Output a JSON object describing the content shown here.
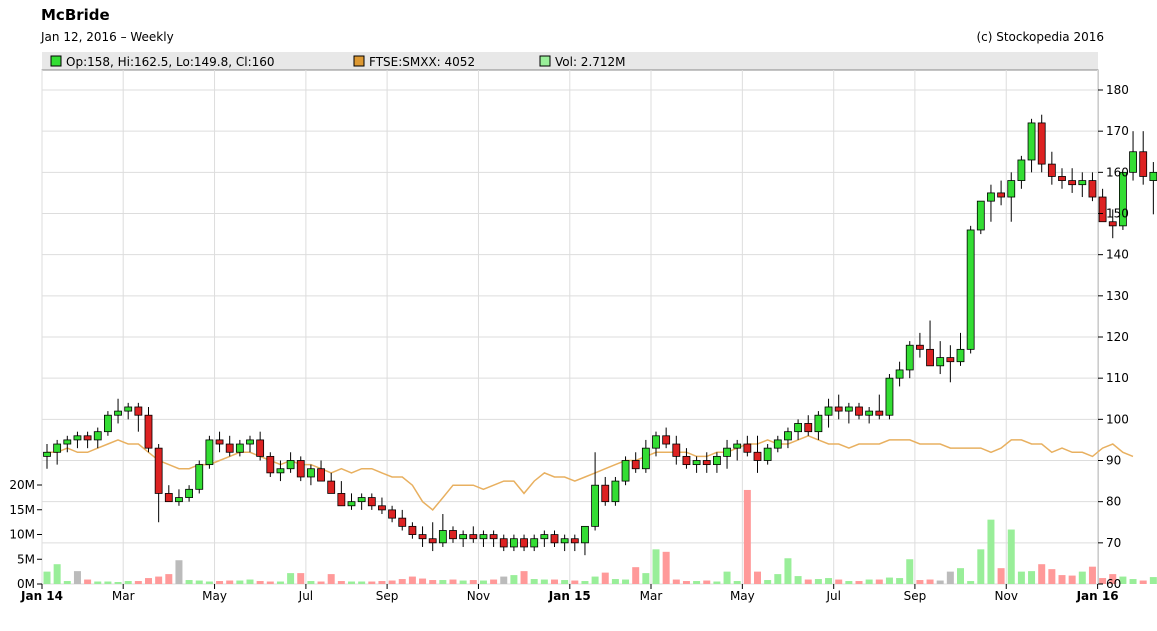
{
  "header": {
    "title": "McBride",
    "subtitle": "Jan 12, 2016 – Weekly",
    "credit": "(c) Stockopedia 2016"
  },
  "legend": [
    {
      "label": "Op:158, Hi:162.5, Lo:149.8, Cl:160",
      "color": "#33dd33"
    },
    {
      "label": "FTSE:SMXX: 4052",
      "color": "#dd9933"
    },
    {
      "label": "Vol: 2.712M",
      "color": "#99ee99"
    }
  ],
  "chart_data": {
    "type": "candlestick",
    "period": "Weekly",
    "x_range": [
      "2014-01-06",
      "2016-01-11"
    ],
    "y_right": {
      "min": 60,
      "max": 185,
      "ticks": [
        60,
        70,
        80,
        90,
        100,
        110,
        120,
        130,
        140,
        150,
        160,
        170,
        180
      ]
    },
    "volume_axis": {
      "unit": "M",
      "ticks": [
        "0M",
        "5M",
        "10M",
        "15M",
        "20M"
      ],
      "values": [
        0,
        5,
        10,
        15,
        20
      ]
    },
    "x_ticks": [
      {
        "label": "Jan 14",
        "bold": true,
        "week": 0
      },
      {
        "label": "Mar",
        "bold": false,
        "week": 8
      },
      {
        "label": "May",
        "bold": false,
        "week": 17
      },
      {
        "label": "Jul",
        "bold": false,
        "week": 26
      },
      {
        "label": "Sep",
        "bold": false,
        "week": 34
      },
      {
        "label": "Nov",
        "bold": false,
        "week": 43
      },
      {
        "label": "Jan 15",
        "bold": true,
        "week": 52
      },
      {
        "label": "Mar",
        "bold": false,
        "week": 60
      },
      {
        "label": "May",
        "bold": false,
        "week": 69
      },
      {
        "label": "Jul",
        "bold": false,
        "week": 78
      },
      {
        "label": "Sep",
        "bold": false,
        "week": 86
      },
      {
        "label": "Nov",
        "bold": false,
        "week": 95
      },
      {
        "label": "Jan 16",
        "bold": true,
        "week": 104
      }
    ],
    "colors": {
      "up": "#33dd33",
      "down": "#dd2222",
      "index": "#e8b060",
      "vol_up": "#99ee99",
      "vol_down": "#ff9999",
      "vol_flat": "#bbbbbb"
    },
    "candles": [
      [
        91,
        94,
        88,
        92
      ],
      [
        92,
        95,
        89,
        94
      ],
      [
        94,
        96,
        92,
        95
      ],
      [
        95,
        97,
        93,
        96
      ],
      [
        96,
        97,
        93,
        95
      ],
      [
        95,
        98,
        93,
        97
      ],
      [
        97,
        102,
        96,
        101
      ],
      [
        101,
        105,
        99,
        102
      ],
      [
        102,
        104,
        100,
        103
      ],
      [
        103,
        104,
        97,
        101
      ],
      [
        101,
        103,
        92,
        93
      ],
      [
        93,
        94,
        75,
        82
      ],
      [
        82,
        84,
        80,
        80
      ],
      [
        80,
        83,
        79,
        81
      ],
      [
        81,
        84,
        80,
        83
      ],
      [
        83,
        90,
        82,
        89
      ],
      [
        89,
        96,
        88,
        95
      ],
      [
        95,
        97,
        92,
        94
      ],
      [
        94,
        96,
        91,
        92
      ],
      [
        92,
        95,
        91,
        94
      ],
      [
        94,
        96,
        92,
        95
      ],
      [
        95,
        97,
        90,
        91
      ],
      [
        91,
        92,
        86,
        87
      ],
      [
        87,
        90,
        85,
        88
      ],
      [
        88,
        92,
        87,
        90
      ],
      [
        90,
        91,
        85,
        86
      ],
      [
        86,
        89,
        84,
        88
      ],
      [
        88,
        90,
        85,
        85
      ],
      [
        85,
        87,
        82,
        82
      ],
      [
        82,
        85,
        79,
        79
      ],
      [
        79,
        82,
        78,
        80
      ],
      [
        80,
        82,
        78,
        81
      ],
      [
        81,
        82,
        78,
        79
      ],
      [
        79,
        81,
        77,
        78
      ],
      [
        78,
        79,
        75,
        76
      ],
      [
        76,
        78,
        73,
        74
      ],
      [
        74,
        75,
        71,
        72
      ],
      [
        72,
        74,
        69,
        71
      ],
      [
        71,
        75,
        68,
        70
      ],
      [
        70,
        77,
        69,
        73
      ],
      [
        73,
        74,
        70,
        71
      ],
      [
        71,
        73,
        69,
        72
      ],
      [
        72,
        74,
        70,
        71
      ],
      [
        71,
        73,
        69,
        72
      ],
      [
        72,
        73,
        69,
        71
      ],
      [
        71,
        72,
        68,
        69
      ],
      [
        69,
        72,
        68,
        71
      ],
      [
        71,
        72,
        68,
        69
      ],
      [
        69,
        72,
        68,
        71
      ],
      [
        71,
        73,
        69,
        72
      ],
      [
        72,
        73,
        69,
        70
      ],
      [
        70,
        72,
        68,
        71
      ],
      [
        71,
        72,
        68,
        70
      ],
      [
        70,
        74,
        67,
        74
      ],
      [
        74,
        92,
        73,
        84
      ],
      [
        84,
        86,
        79,
        80
      ],
      [
        80,
        86,
        79,
        85
      ],
      [
        85,
        91,
        84,
        90
      ],
      [
        90,
        92,
        87,
        88
      ],
      [
        88,
        95,
        87,
        93
      ],
      [
        93,
        97,
        91,
        96
      ],
      [
        96,
        98,
        93,
        94
      ],
      [
        94,
        96,
        89,
        91
      ],
      [
        91,
        93,
        88,
        89
      ],
      [
        89,
        91,
        87,
        90
      ],
      [
        90,
        92,
        87,
        89
      ],
      [
        89,
        92,
        87,
        91
      ],
      [
        91,
        95,
        88,
        93
      ],
      [
        93,
        95,
        90,
        94
      ],
      [
        94,
        96,
        91,
        92
      ],
      [
        92,
        96,
        87,
        90
      ],
      [
        90,
        94,
        89,
        93
      ],
      [
        93,
        96,
        92,
        95
      ],
      [
        95,
        98,
        93,
        97
      ],
      [
        97,
        100,
        95,
        99
      ],
      [
        99,
        101,
        96,
        97
      ],
      [
        97,
        102,
        95,
        101
      ],
      [
        101,
        105,
        98,
        103
      ],
      [
        103,
        106,
        100,
        102
      ],
      [
        102,
        104,
        99,
        103
      ],
      [
        103,
        104,
        100,
        101
      ],
      [
        101,
        103,
        99,
        102
      ],
      [
        102,
        106,
        100,
        101
      ],
      [
        101,
        111,
        100,
        110
      ],
      [
        110,
        114,
        108,
        112
      ],
      [
        112,
        119,
        110,
        118
      ],
      [
        118,
        121,
        115,
        117
      ],
      [
        117,
        124,
        115,
        113
      ],
      [
        113,
        119,
        111,
        115
      ],
      [
        115,
        118,
        109,
        114
      ],
      [
        114,
        121,
        113,
        117
      ],
      [
        117,
        147,
        116,
        146
      ],
      [
        146,
        152,
        145,
        153
      ],
      [
        153,
        157,
        148,
        155
      ],
      [
        155,
        158,
        152,
        154
      ],
      [
        154,
        160,
        148,
        158
      ],
      [
        158,
        164,
        156,
        163
      ],
      [
        163,
        173,
        160,
        172
      ],
      [
        172,
        174,
        160,
        162
      ],
      [
        162,
        165,
        157,
        159
      ],
      [
        159,
        161,
        156,
        158
      ],
      [
        158,
        161,
        155,
        157
      ],
      [
        157,
        160,
        154,
        158
      ],
      [
        158,
        160,
        153,
        154
      ],
      [
        154,
        156,
        148,
        148
      ],
      [
        148,
        151,
        144,
        147
      ],
      [
        147,
        160,
        146,
        160
      ],
      [
        160,
        170,
        158,
        165
      ],
      [
        165,
        170,
        157,
        159
      ],
      [
        158,
        162.5,
        149.8,
        160
      ]
    ],
    "volume": [
      2.5,
      4.0,
      0.6,
      2.6,
      0.9,
      0.5,
      0.5,
      0.4,
      0.6,
      0.6,
      1.2,
      1.5,
      2.0,
      4.8,
      0.8,
      0.7,
      0.5,
      0.6,
      0.7,
      0.7,
      0.9,
      0.6,
      0.5,
      0.5,
      2.2,
      2.2,
      0.6,
      0.5,
      2.0,
      0.6,
      0.5,
      0.5,
      0.5,
      0.6,
      0.7,
      1.0,
      1.5,
      1.1,
      0.8,
      0.8,
      0.9,
      0.7,
      0.8,
      0.7,
      0.9,
      1.5,
      1.8,
      2.6,
      1.0,
      0.9,
      0.9,
      0.8,
      0.7,
      0.6,
      1.5,
      2.3,
      1.0,
      0.9,
      3.4,
      2.2,
      7.0,
      6.5,
      0.9,
      0.6,
      0.6,
      0.7,
      0.5,
      2.5,
      0.6,
      19.0,
      2.5,
      0.8,
      2.0,
      5.2,
      1.6,
      0.9,
      1.0,
      1.2,
      0.9,
      0.6,
      0.6,
      0.9,
      0.9,
      1.3,
      1.2,
      5.0,
      0.8,
      0.9,
      0.7,
      2.5,
      3.2,
      0.6,
      7.0,
      13.0,
      3.2,
      11.0,
      2.5,
      2.6,
      4.0,
      3.0,
      1.8,
      1.7,
      2.5,
      3.5,
      1.2,
      2.0,
      1.5,
      1.0,
      0.7,
      1.4,
      0.9,
      2.7
    ],
    "volume_gray_weeks": [
      3,
      13,
      45,
      88,
      89
    ],
    "index_line": [
      92,
      92,
      93,
      92,
      92,
      93,
      94,
      95,
      94,
      94,
      92,
      90,
      89,
      88,
      88,
      89,
      89,
      90,
      91,
      92,
      92,
      91,
      90,
      89,
      90,
      89,
      89,
      88,
      87,
      88,
      87,
      88,
      88,
      87,
      86,
      86,
      84,
      80,
      78,
      81,
      84,
      84,
      84,
      83,
      84,
      85,
      85,
      82,
      85,
      87,
      86,
      86,
      85,
      86,
      87,
      88,
      89,
      90,
      90,
      91,
      92,
      92,
      92,
      92,
      91,
      91,
      92,
      92,
      93,
      94,
      94,
      95,
      94,
      94,
      95,
      96,
      95,
      94,
      94,
      93,
      94,
      94,
      94,
      95,
      95,
      95,
      94,
      94,
      94,
      93,
      93,
      93,
      93,
      92,
      93,
      95,
      95,
      94,
      94,
      92,
      93,
      92,
      92,
      91,
      93,
      94,
      92,
      91
    ]
  }
}
